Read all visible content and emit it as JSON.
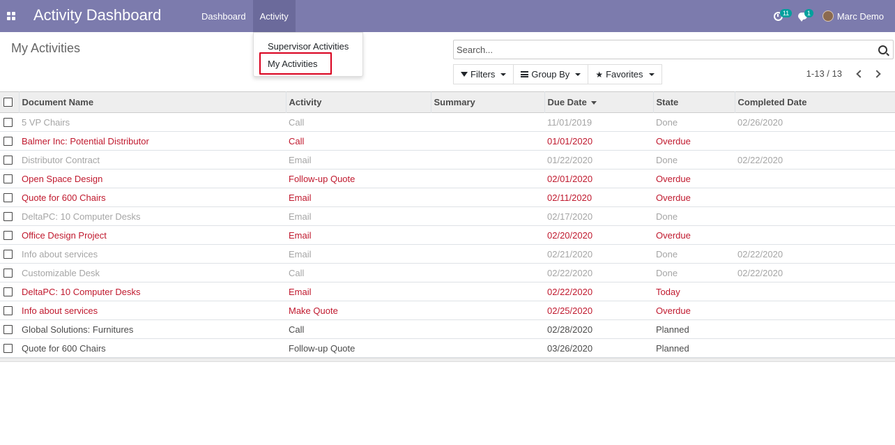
{
  "navbar": {
    "title": "Activity Dashboard",
    "menu": [
      {
        "label": "Dashboard",
        "active": false
      },
      {
        "label": "Activity",
        "active": true
      }
    ],
    "activity_count": "11",
    "message_count": "1",
    "user_name": "Marc Demo"
  },
  "dropdown": {
    "items": [
      "Supervisor Activities",
      "My Activities"
    ]
  },
  "page": {
    "title": "My Activities"
  },
  "search": {
    "placeholder": "Search..."
  },
  "filters": {
    "filters_label": "Filters",
    "groupby_label": "Group By",
    "favorites_label": "Favorites"
  },
  "pager": {
    "value": "1-13 / 13"
  },
  "table": {
    "columns": [
      "Document Name",
      "Activity",
      "Summary",
      "Due Date",
      "State",
      "Completed Date"
    ],
    "rows": [
      {
        "doc": "5 VP Chairs",
        "activity": "Call",
        "summary": "",
        "due": "11/01/2019",
        "state": "Done",
        "completed": "02/26/2020",
        "status": "done"
      },
      {
        "doc": "Balmer Inc: Potential Distributor",
        "activity": "Call",
        "summary": "",
        "due": "01/01/2020",
        "state": "Overdue",
        "completed": "",
        "status": "overdue"
      },
      {
        "doc": "Distributor Contract",
        "activity": "Email",
        "summary": "",
        "due": "01/22/2020",
        "state": "Done",
        "completed": "02/22/2020",
        "status": "done"
      },
      {
        "doc": "Open Space Design",
        "activity": "Follow-up Quote",
        "summary": "",
        "due": "02/01/2020",
        "state": "Overdue",
        "completed": "",
        "status": "overdue"
      },
      {
        "doc": "Quote for 600 Chairs",
        "activity": "Email",
        "summary": "",
        "due": "02/11/2020",
        "state": "Overdue",
        "completed": "",
        "status": "overdue"
      },
      {
        "doc": "DeltaPC: 10 Computer Desks",
        "activity": "Email",
        "summary": "",
        "due": "02/17/2020",
        "state": "Done",
        "completed": "",
        "status": "done"
      },
      {
        "doc": "Office Design Project",
        "activity": "Email",
        "summary": "",
        "due": "02/20/2020",
        "state": "Overdue",
        "completed": "",
        "status": "overdue"
      },
      {
        "doc": "Info about services",
        "activity": "Email",
        "summary": "",
        "due": "02/21/2020",
        "state": "Done",
        "completed": "02/22/2020",
        "status": "done"
      },
      {
        "doc": "Customizable Desk",
        "activity": "Call",
        "summary": "",
        "due": "02/22/2020",
        "state": "Done",
        "completed": "02/22/2020",
        "status": "done"
      },
      {
        "doc": "DeltaPC: 10 Computer Desks",
        "activity": "Email",
        "summary": "",
        "due": "02/22/2020",
        "state": "Today",
        "completed": "",
        "status": "overdue"
      },
      {
        "doc": "Info about services",
        "activity": "Make Quote",
        "summary": "",
        "due": "02/25/2020",
        "state": "Overdue",
        "completed": "",
        "status": "overdue"
      },
      {
        "doc": "Global Solutions: Furnitures",
        "activity": "Call",
        "summary": "",
        "due": "02/28/2020",
        "state": "Planned",
        "completed": "",
        "status": "planned"
      },
      {
        "doc": "Quote for 600 Chairs",
        "activity": "Follow-up Quote",
        "summary": "",
        "due": "03/26/2020",
        "state": "Planned",
        "completed": "",
        "status": "planned"
      }
    ]
  },
  "colors": {
    "navbar": "#7c7bad",
    "overdue": "#c0192e",
    "done": "#a5a5a5",
    "badge": "#00a09d",
    "highlight": "#d9001e"
  }
}
